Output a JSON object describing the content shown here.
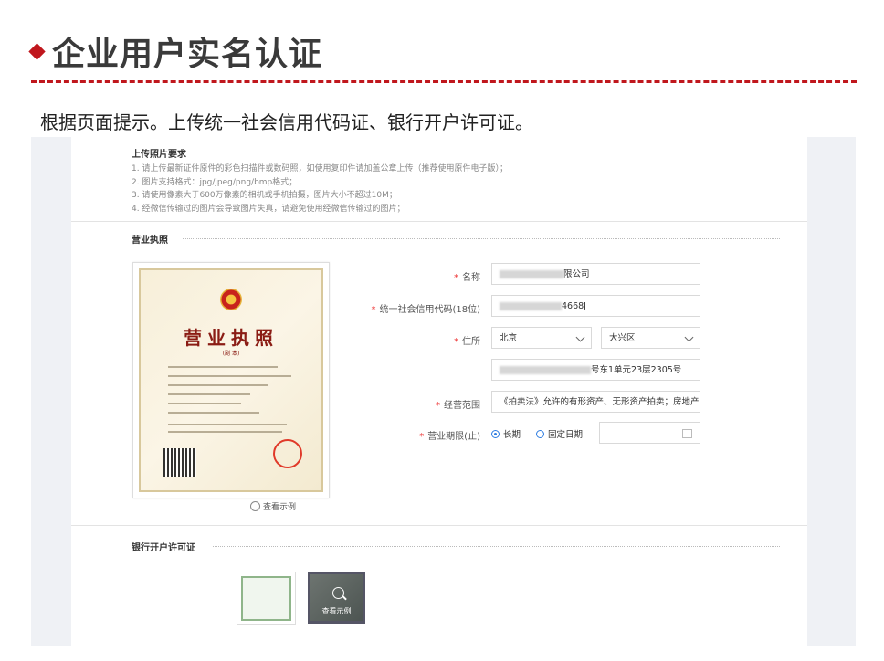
{
  "slide": {
    "title": "企业用户实名认证",
    "intro": "根据页面提示。上传统一社会信用代码证、银行开户许可证。"
  },
  "requirements": {
    "title": "上传照片要求",
    "items": [
      "1. 请上传最新证件原件的彩色扫描件或数码照，如使用复印件请加盖公章上传（推荐使用原件电子版）；",
      "2. 图片支持格式：jpg/jpeg/png/bmp格式；",
      "3. 请使用像素大于600万像素的相机或手机拍摄，图片大小不超过10M；",
      "4. 经微信传输过的图片会导致图片失真，请避免使用经微信传输过的图片；"
    ]
  },
  "business_license": {
    "section_title": "营业执照",
    "image_title": "营业执照",
    "image_subtitle": "(副 本)",
    "view_example": "查看示例"
  },
  "form": {
    "name": {
      "label": "名称",
      "value_suffix": "限公司"
    },
    "credit_code": {
      "label": "统一社会信用代码(18位)",
      "value_suffix": "4668J"
    },
    "address": {
      "label": "住所",
      "city": "北京",
      "district": "大兴区",
      "detail_suffix": "号东1单元23层2305号"
    },
    "scope": {
      "label": "经营范围",
      "value": "《拍卖法》允许的有形资产、无形资产拍卖；房地产营"
    },
    "term": {
      "label": "营业期限(止)",
      "option_long": "长期",
      "option_fixed": "固定日期",
      "selected": "长期"
    }
  },
  "bank_permit": {
    "section_title": "银行开户许可证",
    "view_example": "查看示例"
  },
  "colors": {
    "accent_red": "#c0171d",
    "link_blue": "#2f7de1",
    "required_star": "#e33"
  }
}
